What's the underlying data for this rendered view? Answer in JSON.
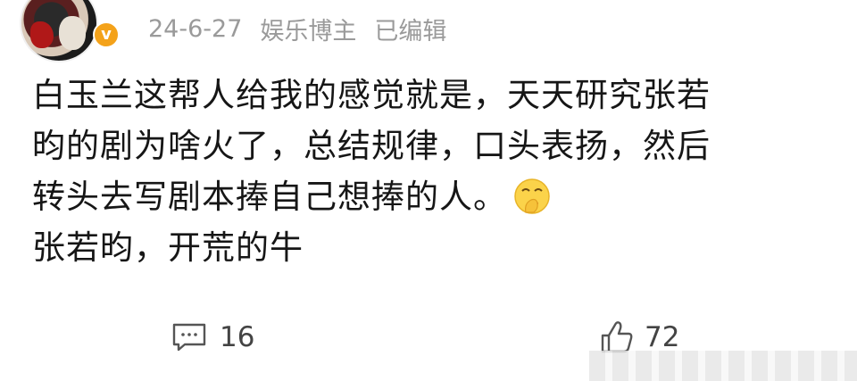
{
  "post": {
    "date": "24-6-27",
    "source": "娱乐博主",
    "edited": "已编辑",
    "lines": [
      "白玉兰这帮人给我的感觉就是，天天研究张若",
      "昀的剧为啥火了，总结规律，口头表扬，然后",
      "转头去写剧本捧自己想捧的人。",
      "张若昀，开荒的牛"
    ]
  },
  "actions": {
    "comments": "16",
    "likes": "72"
  },
  "icons": {
    "avatar": "user-avatar",
    "verified": "verified-badge-icon",
    "emoji": "shush-face-emoji",
    "comment": "comment-icon",
    "like": "thumbs-up-icon"
  },
  "colors": {
    "badge": "#f4a21a",
    "meta_text": "#9a9a9a",
    "body_text": "#161616"
  }
}
